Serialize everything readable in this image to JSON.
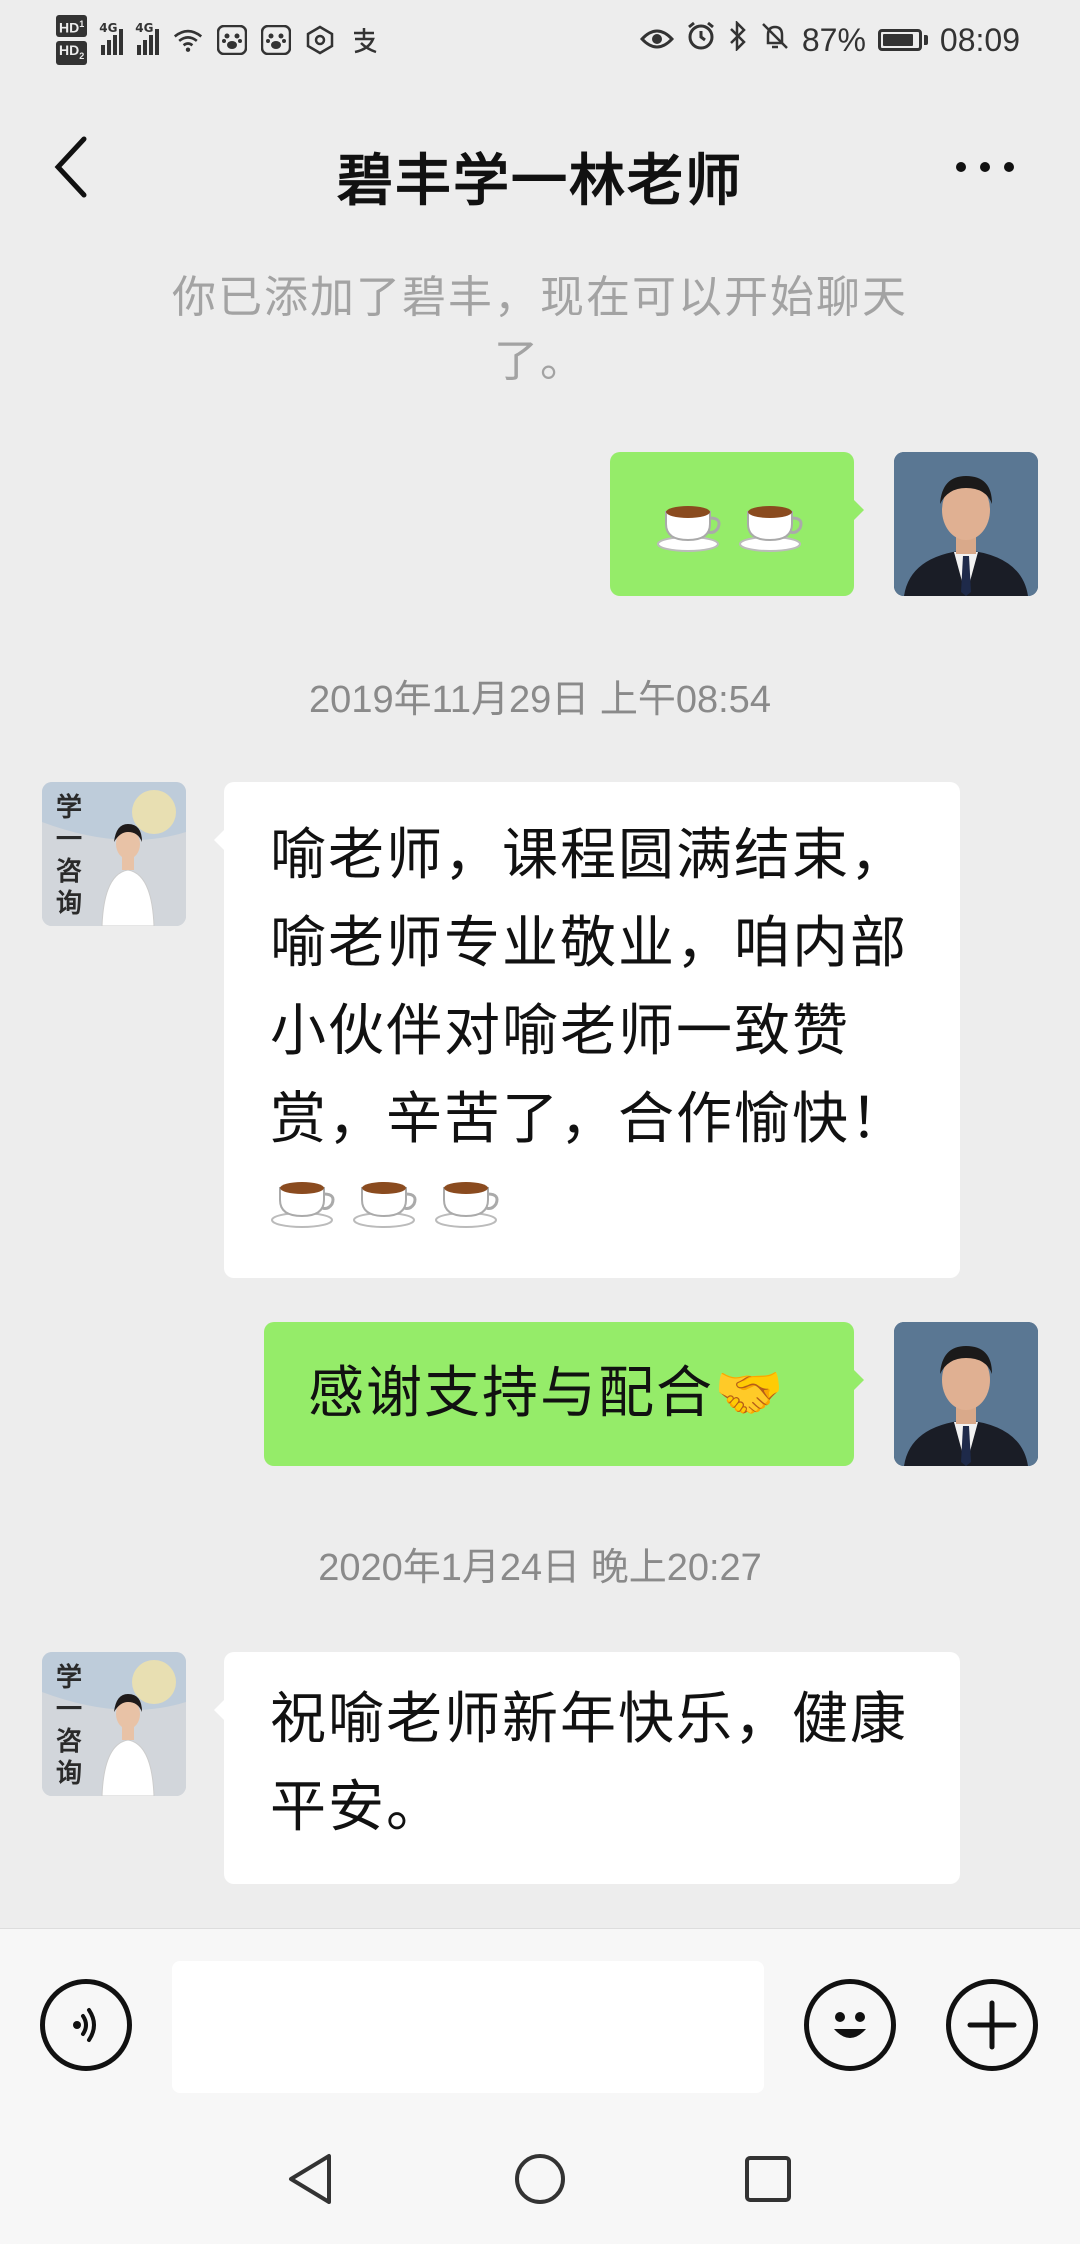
{
  "status_bar": {
    "hd1": "HD",
    "hd1_sub": "1",
    "hd2": "HD",
    "hd2_sub": "2",
    "net1": "4G",
    "net2": "4G",
    "battery": "87%",
    "time": "08:09",
    "icons": [
      "signal-icon",
      "wifi-icon",
      "baidu-paw-icon",
      "baidu-paw-icon",
      "shield-hexagon-icon",
      "alipay-icon",
      "eye-icon",
      "alarm-icon",
      "bluetooth-icon",
      "mute-bell-icon",
      "battery-icon"
    ]
  },
  "nav": {
    "title": "碧丰学一林老师",
    "back_icon": "chevron-left-icon",
    "more_icon": "more-dots-icon"
  },
  "chat": {
    "system_message": "你已添加了碧丰，现在可以开始聊天了。",
    "messages": [
      {
        "side": "me",
        "text": "☕☕"
      },
      {
        "timestamp": "2019年11月29日 上午08:54"
      },
      {
        "side": "other",
        "lines": [
          "喻老师，课程圆满结束，",
          "喻老师专业敬业，咱内部",
          "小伙伴对喻老师一致赞",
          "赏，辛苦了，合作愉快！"
        ],
        "emoji": "☕☕☕"
      },
      {
        "side": "me",
        "text": "感谢支持与配合🤝"
      },
      {
        "timestamp": "2020年1月24日 晚上20:27"
      },
      {
        "side": "other",
        "lines": [
          "祝喻老师新年快乐，健康",
          "平安。"
        ]
      }
    ],
    "avatar_other_text": [
      "学",
      "一",
      "咨",
      "询"
    ]
  },
  "input_bar": {
    "voice_icon": "voice-icon",
    "emoji_icon": "smiley-icon",
    "plus_icon": "plus-icon",
    "input_value": ""
  },
  "system_nav": {
    "icons": [
      "nav-back-triangle-icon",
      "nav-home-circle-icon",
      "nav-recents-square-icon"
    ]
  }
}
